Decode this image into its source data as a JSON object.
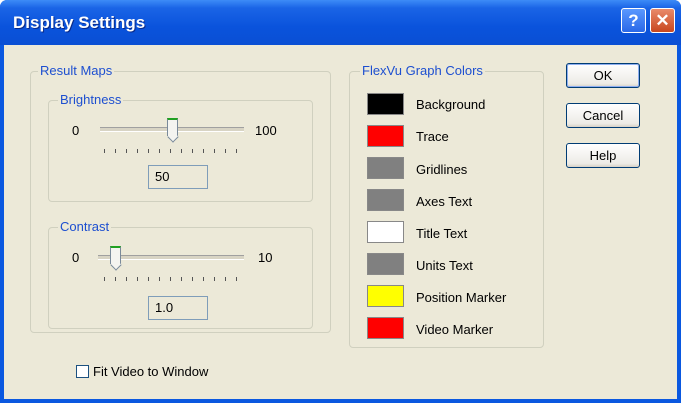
{
  "window": {
    "title": "Display Settings"
  },
  "titlebar_buttons": {
    "help": "?",
    "close": "✕"
  },
  "result_maps": {
    "label": "Result Maps",
    "brightness": {
      "label": "Brightness",
      "min": "0",
      "max": "100",
      "value": "50",
      "level": 50
    },
    "contrast": {
      "label": "Contrast",
      "min": "0",
      "max": "10",
      "value": "1.0",
      "level": 1.0
    }
  },
  "graph_colors": {
    "label": "FlexVu Graph Colors",
    "items": [
      {
        "name": "Background",
        "color": "#000000"
      },
      {
        "name": "Trace",
        "color": "#ff0000"
      },
      {
        "name": "Gridlines",
        "color": "#808080"
      },
      {
        "name": "Axes Text",
        "color": "#808080"
      },
      {
        "name": "Title Text",
        "color": "#ffffff"
      },
      {
        "name": "Units Text",
        "color": "#808080"
      },
      {
        "name": "Position Marker",
        "color": "#ffff00"
      },
      {
        "name": "Video Marker",
        "color": "#ff0000"
      }
    ]
  },
  "buttons": {
    "ok": "OK",
    "cancel": "Cancel",
    "help": "Help"
  },
  "fit_video": {
    "label": "Fit Video to Window",
    "checked": false
  }
}
